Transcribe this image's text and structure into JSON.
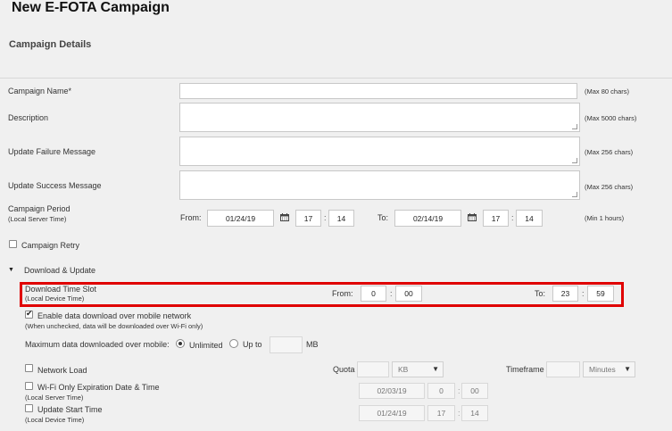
{
  "page": {
    "title": "New E-FOTA Campaign",
    "section_title": "Campaign Details"
  },
  "fields": {
    "campaign_name": {
      "label": "Campaign Name*",
      "hint": "(Max 80 chars)",
      "value": ""
    },
    "description": {
      "label": "Description",
      "hint": "(Max 5000 chars)",
      "value": ""
    },
    "failure_msg": {
      "label": "Update Failure Message",
      "hint": "(Max 256 chars)",
      "value": ""
    },
    "success_msg": {
      "label": "Update Success Message",
      "hint": "(Max 256 chars)",
      "value": ""
    }
  },
  "period": {
    "label": "Campaign Period",
    "sublabel": "(Local Server Time)",
    "from_label": "From:",
    "from_date": "01/24/19",
    "from_hour": "17",
    "from_min": "14",
    "to_label": "To:",
    "to_date": "02/14/19",
    "to_hour": "17",
    "to_min": "14",
    "hint": "(Min 1 hours)"
  },
  "retry": {
    "label": "Campaign Retry",
    "checked": false
  },
  "download_update": {
    "label": "Download & Update",
    "expanded": true
  },
  "time_slot": {
    "label": "Download Time Slot",
    "sublabel": "(Local Device Time)",
    "from_label": "From:",
    "from_hour": "0",
    "from_min": "00",
    "to_label": "To:",
    "to_hour": "23",
    "to_min": "59"
  },
  "mobile_data": {
    "label": "Enable data download over mobile network",
    "sublabel": "(When unchecked, data will be downloaded over Wi-Fi only)",
    "checked": true
  },
  "max_data": {
    "label": "Maximum data downloaded over mobile:",
    "unlimited": "Unlimited",
    "upto": "Up to",
    "value": "",
    "unit": "MB",
    "selected": "unlimited"
  },
  "network_load": {
    "label": "Network Load",
    "checked": false,
    "quota_label": "Quota",
    "quota_value": "",
    "quota_unit": "KB",
    "timeframe_label": "Timeframe",
    "timeframe_value": "",
    "timeframe_unit": "Minutes"
  },
  "wifi_expiration": {
    "label": "Wi-Fi Only Expiration Date & Time",
    "sublabel": "(Local Server Time)",
    "checked": false,
    "date": "02/03/19",
    "hour": "0",
    "min": "00"
  },
  "update_start": {
    "label": "Update Start Time",
    "sublabel": "(Local Device Time)",
    "checked": false,
    "date": "01/24/19",
    "hour": "17",
    "min": "14"
  },
  "colon": ":",
  "icons": {
    "calendar": "calendar-icon",
    "dropdown": "chevron-down-icon",
    "collapse": "triangle-down-icon"
  }
}
